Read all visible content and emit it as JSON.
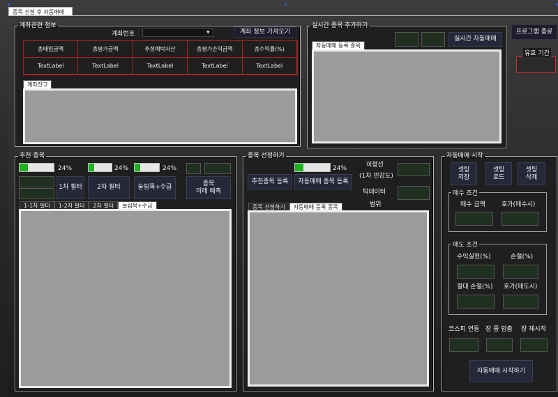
{
  "window": {
    "tab_title": "종목 선정 후 자동매매"
  },
  "account_info": {
    "title": "계좌관련 정보",
    "account_label": "계좌번호",
    "account_value": "",
    "fetch_button": "계좌 정보 가져오기",
    "headers": [
      "총매입금액",
      "총평가금액",
      "추정예탁자산",
      "총평가손익금액",
      "총수익률(%)"
    ],
    "values": [
      "TextLabel",
      "TextLabel",
      "TextLabel",
      "TextLabel",
      "TextLabel"
    ],
    "balance_tab": "계좌잔고"
  },
  "realtime": {
    "title": "실시간 종목 추가하기",
    "auto_button": "실시간 자동매매",
    "list_tab": "자동매매 등록 종목"
  },
  "sidebar": {
    "exit_button": "프로그램 종료",
    "valid_period_label": "유효 기간"
  },
  "recommend": {
    "title": "추천 종목",
    "progress": [
      {
        "percent_text": "24%",
        "value": 0.24
      },
      {
        "percent_text": "24%",
        "value": 0.24
      },
      {
        "percent_text": "24%",
        "value": 0.24
      }
    ],
    "filter1_button": "1차 필터",
    "filter2_button": "2차 필터",
    "filter3_button": "눌림목+수급",
    "predict_button": "종목\n미래 예측",
    "tabs": [
      "1-1차 필터",
      "1-2차 필터",
      "2차 필터",
      "눌림목+수급"
    ],
    "active_tab": 3
  },
  "select_stock": {
    "title": "종목 선정하기",
    "progress": {
      "percent_text": "24%",
      "value": 0.24
    },
    "ma_label": "이평선",
    "sensitivity_label": "(1차 민감도)",
    "register_recommend_button": "추천종목 등록",
    "register_auto_button": "자동매매 종목 등록",
    "tick_label": "틱데이터",
    "range_label": "범위",
    "tabs": [
      "종목 선정하기",
      "자동매매 등록 종목"
    ],
    "active_tab": 1
  },
  "auto_trade": {
    "title": "자동매매 시작",
    "save_button": "셋팅\n저장",
    "load_button": "셋팅\n로드",
    "delete_button": "셋팅\n삭제",
    "buy_conditions": {
      "title": "매수 조건",
      "amount_label": "매수 금액",
      "price_label": "호가(매수시)"
    },
    "sell_conditions": {
      "title": "매도 조건",
      "profit_label": "수익실현(%)",
      "loss_label": "손절(%)",
      "abs_loss_label": "절대 손절(%)",
      "price_label": "호가(매도시)"
    },
    "kospi_label": "코스피 연동",
    "halt_label": "장 중 멈춤",
    "restart_label": "장 재시작",
    "start_button": "자동매매 시작하기"
  }
}
